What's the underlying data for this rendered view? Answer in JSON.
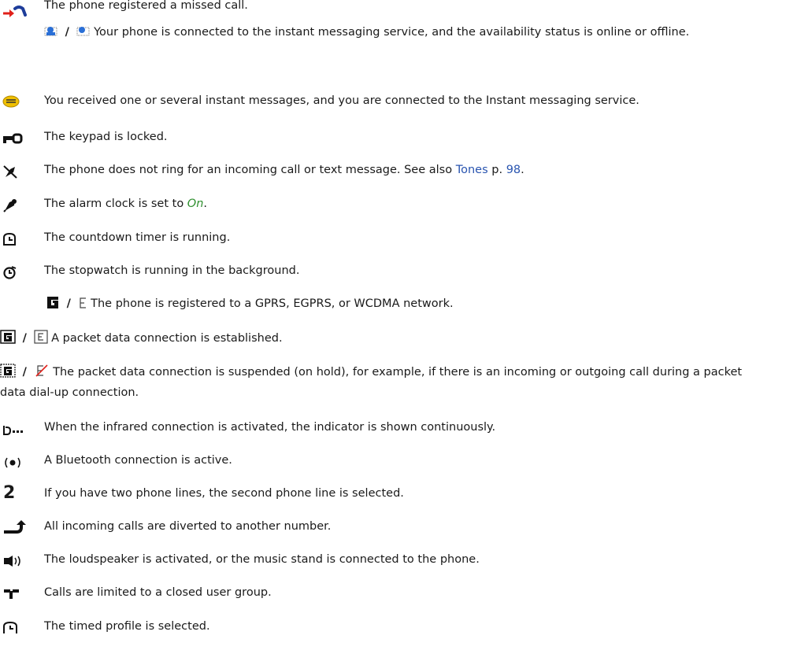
{
  "entries": [
    {
      "icon": "missed-call-icon",
      "text": "The phone registered a missed call."
    },
    {
      "icons": [
        "im-online-icon",
        "im-offline-icon"
      ],
      "sep": "/",
      "text": "Your phone is connected to the instant messaging service, and the availability status is online or offline."
    },
    {
      "icon": "instant-message-icon",
      "text": "You received one or several instant messages, and you are connected to the Instant messaging service."
    },
    {
      "icon": "keypad-locked-icon",
      "text": "The keypad is locked."
    },
    {
      "icon": "silent-icon",
      "text_before": "The phone does not ring for an incoming call or text message. See also ",
      "link": "Tones",
      "text_mid": " p. ",
      "page": "98",
      "text_after": "."
    },
    {
      "icon": "alarm-clock-icon",
      "text_before": "The alarm clock is set to ",
      "emphasis": "On",
      "text_after": "."
    },
    {
      "icon": "countdown-timer-icon",
      "text": "The countdown timer is running."
    },
    {
      "icon": "stopwatch-icon",
      "text": "The stopwatch is running in the background."
    },
    {
      "icons": [
        "gprs-icon",
        "egprs-icon"
      ],
      "sep": "/",
      "text": "The phone is registered to a GPRS, EGPRS, or WCDMA network."
    },
    {
      "icons": [
        "gprs-active-icon",
        "egprs-active-icon"
      ],
      "sep": "/",
      "text": "A packet data connection is established."
    },
    {
      "icons": [
        "gprs-suspended-icon",
        "egprs-suspended-icon"
      ],
      "sep": "/",
      "text": "The packet data connection is suspended (on hold), for example, if there is an incoming or outgoing call during a packet data dial-up connection."
    },
    {
      "icon": "infrared-icon",
      "text": "When the infrared connection is activated, the indicator is shown continuously."
    },
    {
      "icon": "bluetooth-icon",
      "text": "A Bluetooth connection is active."
    },
    {
      "icon": "phone-line-2-icon",
      "text": "If you have two phone lines, the second phone line is selected."
    },
    {
      "icon": "call-divert-icon",
      "text": "All incoming calls are diverted to another number."
    },
    {
      "icon": "loudspeaker-icon",
      "text": "The loudspeaker is activated, or the music stand is connected to the phone."
    },
    {
      "icon": "closed-user-group-icon",
      "text": "Calls are limited to a closed user group."
    },
    {
      "icon": "timed-profile-icon",
      "text": "The timed profile is selected."
    }
  ]
}
